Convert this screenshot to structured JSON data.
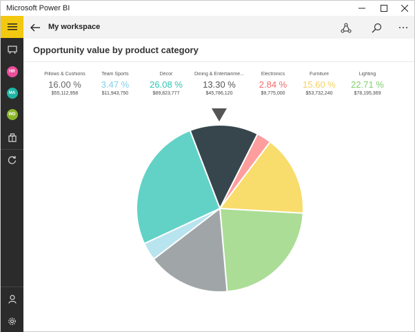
{
  "window": {
    "title": "Microsoft Power BI"
  },
  "sidebar": {
    "avatars": [
      {
        "initials": "HR",
        "color": "#e94e9a"
      },
      {
        "initials": "MA",
        "color": "#1fb5a5"
      },
      {
        "initials": "WD",
        "color": "#8bb62a"
      }
    ]
  },
  "header": {
    "title": "My workspace"
  },
  "report": {
    "title": "Opportunity value by product category"
  },
  "colors": {
    "accent": "#f2c811",
    "sidebar": "#2b2b2b"
  },
  "chart_data": {
    "type": "pie",
    "categories": [
      "Pillows & Cushions",
      "Team Sports",
      "Décor",
      "Dining & Entertainme...",
      "Electronics",
      "Furniture",
      "Lighting"
    ],
    "percent_labels": [
      "16.00 %",
      "3.47 %",
      "26.08 %",
      "13.30 %",
      "2.84 %",
      "15.60 %",
      "22.71 %"
    ],
    "value_labels": [
      "$55,112,958",
      "$11,943,750",
      "$89,823,777",
      "$45,786,120",
      "$9,775,000",
      "$53,732,240",
      "$78,195,369"
    ],
    "percents": [
      16.0,
      3.47,
      26.08,
      13.3,
      2.84,
      15.6,
      22.71
    ],
    "values": [
      55112958,
      11943750,
      89823777,
      45786120,
      9775000,
      53732240,
      78195369
    ],
    "colors": [
      "#a0a5a8",
      "#b8e4ef",
      "#62d2c7",
      "#36464c",
      "#fd9d9d",
      "#f8dc6c",
      "#abdd96"
    ],
    "label_colors": [
      "#666666",
      "#7fd0e4",
      "#2ec4b6",
      "#555555",
      "#f26b6b",
      "#f2d15e",
      "#7fcf6c"
    ],
    "slice_order": [
      3,
      4,
      5,
      6,
      0,
      1,
      2
    ],
    "start_angle_deg": -21
  }
}
